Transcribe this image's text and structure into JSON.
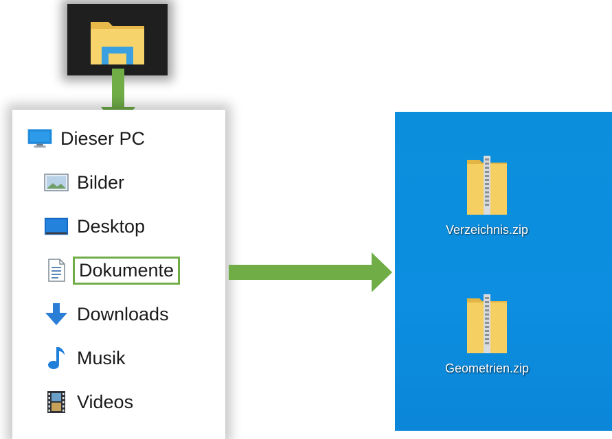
{
  "nav_pane": {
    "root": {
      "label": "Dieser PC",
      "icon": "monitor-icon"
    },
    "items": [
      {
        "label": "Bilder",
        "icon": "pictures-icon"
      },
      {
        "label": "Desktop",
        "icon": "desktop-icon"
      },
      {
        "label": "Dokumente",
        "icon": "documents-icon",
        "highlighted": true
      },
      {
        "label": "Downloads",
        "icon": "download-arrow-icon"
      },
      {
        "label": "Musik",
        "icon": "music-note-icon"
      },
      {
        "label": "Videos",
        "icon": "film-strip-icon"
      }
    ]
  },
  "desktop": {
    "files": [
      {
        "label": "Verzeichnis.zip",
        "icon": "zip-folder-icon"
      },
      {
        "label": "Geometrien.zip",
        "icon": "zip-folder-icon"
      }
    ]
  },
  "colors": {
    "highlight": "#70ad47",
    "desktop_background": "#0d8ee0",
    "explorer_tile": "#1f1f1f"
  }
}
